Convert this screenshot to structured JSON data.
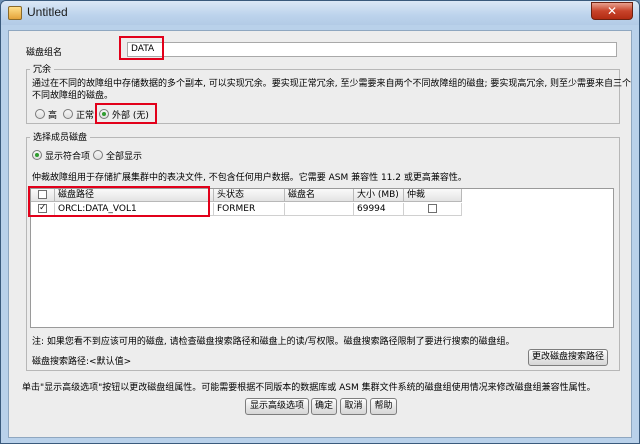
{
  "window": {
    "title": "Untitled",
    "close_label": "✕"
  },
  "name_row": {
    "label": "磁盘组名",
    "value": "DATA"
  },
  "redundancy": {
    "legend": "冗余",
    "description_line1": "通过在不同的故障组中存储数据的多个副本, 可以实现冗余。要实现正常冗余, 至少需要来自两个不同故障组的磁盘; 要实现高冗余, 则至少需要来自三个",
    "description_line2": "不同故障组的磁盘。",
    "options": [
      {
        "label": "高",
        "checked": false
      },
      {
        "label": "正常",
        "checked": false
      },
      {
        "label": "外部 (无)",
        "checked": true
      }
    ]
  },
  "members": {
    "legend": "选择成员磁盘",
    "filter_options": [
      {
        "label": "显示符合项",
        "checked": true
      },
      {
        "label": "全部显示",
        "checked": false
      }
    ],
    "info": "仲裁故障组用于存储扩展集群中的表决文件, 不包含任何用户数据。它需要 ASM 兼容性 11.2 或更高兼容性。",
    "columns": [
      "磁盘路径",
      "头状态",
      "磁盘名",
      "大小 (MB)",
      "仲裁"
    ],
    "rows": [
      {
        "checked": true,
        "path": "ORCL:DATA_VOL1",
        "status": "FORMER",
        "name": "",
        "size": "69994",
        "quorum": false
      }
    ],
    "note": "注: 如果您看不到应该可用的磁盘, 请检查磁盘搜索路径和磁盘上的读/写权限。磁盘搜索路径限制了要进行搜索的磁盘组。",
    "discovery_path_label": "磁盘搜索路径:<默认值>",
    "change_path_button": "更改磁盘搜索路径"
  },
  "footer": {
    "hint": "单击\"显示高级选项\"按钮以更改磁盘组属性。可能需要根据不同版本的数据库或 ASM 集群文件系统的磁盘组使用情况来修改磁盘组兼容性属性。",
    "buttons": {
      "advanced": "显示高级选项",
      "ok": "确定",
      "cancel": "取消",
      "help": "帮助"
    }
  },
  "colors": {
    "highlight": "#e2001a",
    "radio_checked": "#2f9c2f"
  }
}
